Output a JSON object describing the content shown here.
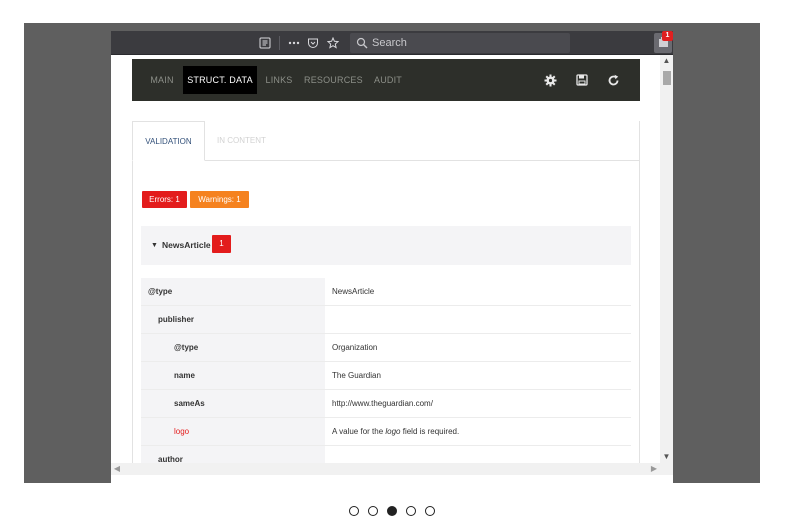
{
  "browser": {
    "search_placeholder": "Search",
    "extension_badge": "1"
  },
  "tabs": [
    {
      "label": "MAIN",
      "active": false
    },
    {
      "label": "STRUCT. DATA",
      "active": true
    },
    {
      "label": "LINKS",
      "active": false
    },
    {
      "label": "RESOURCES",
      "active": false
    },
    {
      "label": "AUDIT",
      "active": false
    }
  ],
  "tab_icons": [
    "gear-icon",
    "save-icon",
    "refresh-icon"
  ],
  "subtabs": [
    {
      "label": "VALIDATION",
      "active": true
    },
    {
      "label": "IN CONTENT",
      "active": false
    }
  ],
  "summary": {
    "errors_label": "Errors: 1",
    "warnings_label": "Warnings: 1"
  },
  "section": {
    "title": "NewsArticle",
    "count": "1"
  },
  "rows": [
    {
      "key": "@type",
      "value": "NewsArticle"
    },
    {
      "key": "publisher",
      "value": ""
    },
    {
      "key": "@type",
      "value": "Organization"
    },
    {
      "key": "name",
      "value": "The Guardian"
    },
    {
      "key": "sameAs",
      "value": "http://www.theguardian.com/"
    },
    {
      "key": "logo",
      "value_prefix": "A value for the ",
      "value_em": "logo",
      "value_suffix": " field is required."
    },
    {
      "key": "author",
      "value": ""
    }
  ],
  "carousel": {
    "count": 5,
    "active_index": 2
  },
  "colors": {
    "stage": "#5f5f5f",
    "tabbar": "#2d2f2a",
    "error": "#e31c1c",
    "warning": "#f5821f",
    "active_subtab": "#33517a"
  }
}
